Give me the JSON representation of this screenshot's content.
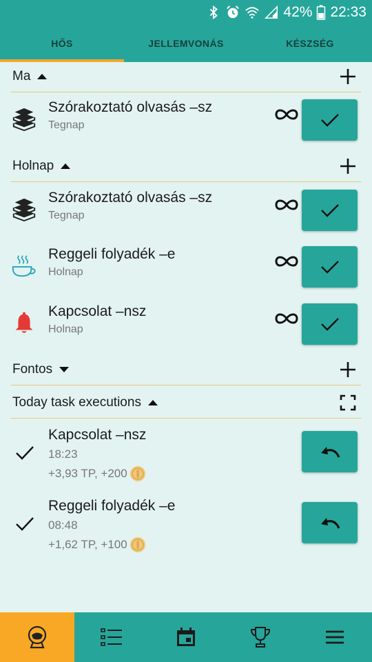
{
  "status_bar": {
    "battery": "42%",
    "time": "22:33"
  },
  "tabs": [
    {
      "label": "HŐS",
      "active": true
    },
    {
      "label": "JELLEMVONÁS",
      "active": false
    },
    {
      "label": "KÉSZSÉG",
      "active": false
    }
  ],
  "sections": {
    "today": {
      "title": "Ma"
    },
    "tomorrow": {
      "title": "Holnap"
    },
    "important": {
      "title": "Fontos"
    },
    "executions": {
      "title": "Today task executions"
    }
  },
  "today_tasks": [
    {
      "name": "Szórakoztató olvasás –sz",
      "subtitle": "Tegnap",
      "icon": "books-icon"
    }
  ],
  "tomorrow_tasks": [
    {
      "name": "Szórakoztató olvasás –sz",
      "subtitle": "Tegnap",
      "icon": "books-icon"
    },
    {
      "name": "Reggeli folyadék –e",
      "subtitle": "Holnap",
      "icon": "coffee-cup-icon"
    },
    {
      "name": "Kapcsolat –nsz",
      "subtitle": "Holnap",
      "icon": "bell-icon"
    }
  ],
  "executions": [
    {
      "name": "Kapcsolat –nsz",
      "time": "18:23",
      "reward": "+3,93 TP, +200"
    },
    {
      "name": "Reggeli folyadék –e",
      "time": "08:48",
      "reward": "+1,62 TP, +100"
    }
  ],
  "colors": {
    "primary": "#26a69a",
    "accent": "#f9a825",
    "background": "#e2f3f1",
    "divider": "#e8c97a"
  },
  "bottom_nav": [
    {
      "icon": "hero-icon",
      "active": true
    },
    {
      "icon": "list-icon",
      "active": false
    },
    {
      "icon": "calendar-icon",
      "active": false
    },
    {
      "icon": "trophy-icon",
      "active": false
    },
    {
      "icon": "menu-icon",
      "active": false
    }
  ]
}
